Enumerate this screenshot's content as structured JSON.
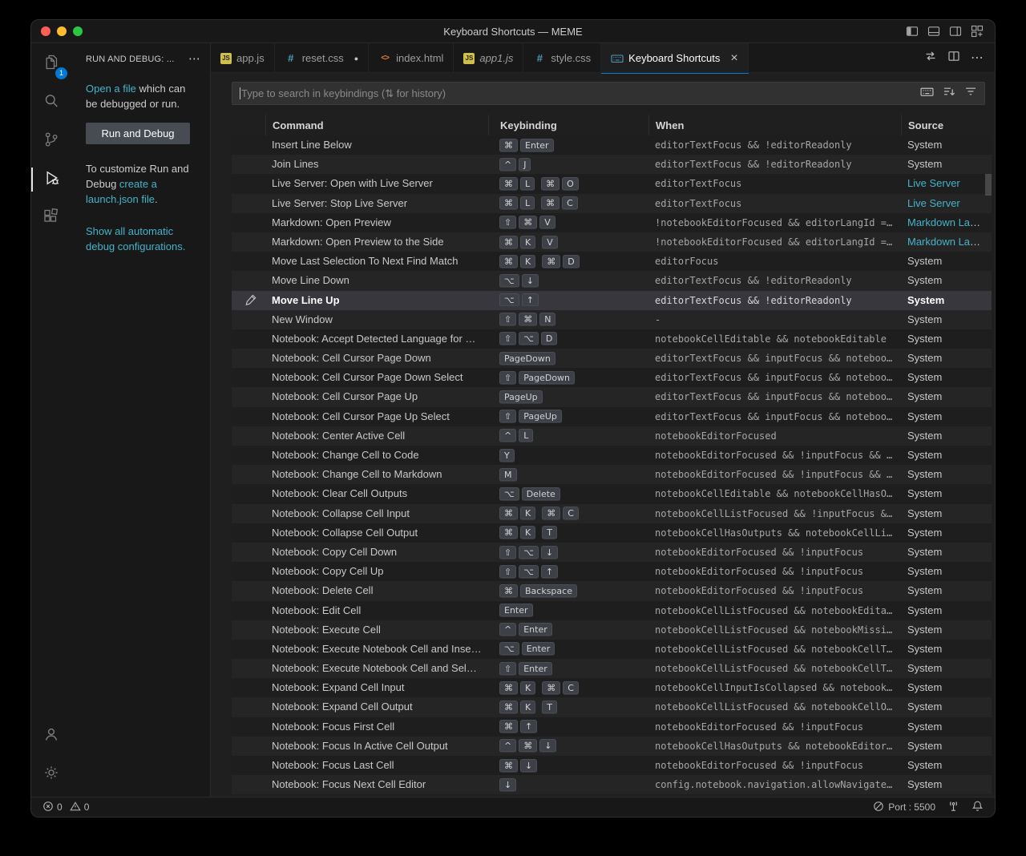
{
  "window": {
    "title": "Keyboard Shortcuts — MEME"
  },
  "titlebar": {
    "controls": [
      "close",
      "minimize",
      "zoom"
    ],
    "layout_icons": [
      "toggle-primary-sidebar",
      "toggle-panel",
      "toggle-secondary-sidebar",
      "customize-layout"
    ]
  },
  "activity_bar": {
    "items": [
      {
        "id": "explorer",
        "icon": "files-icon",
        "badge": "1"
      },
      {
        "id": "search",
        "icon": "search-icon"
      },
      {
        "id": "source-control",
        "icon": "source-control-icon"
      },
      {
        "id": "run-and-debug",
        "icon": "run-debug-icon",
        "active": true
      },
      {
        "id": "extensions",
        "icon": "extensions-icon"
      }
    ],
    "bottom_items": [
      {
        "id": "accounts",
        "icon": "account-icon"
      },
      {
        "id": "settings",
        "icon": "gear-icon"
      }
    ]
  },
  "sidebar": {
    "title": "RUN AND DEBUG: ...",
    "more_actions": "⋯",
    "p1_link": "Open a file",
    "p1_rest": " which can be debugged or run.",
    "run_button": "Run and Debug",
    "p2_pre": "To customize Run and Debug ",
    "p2_link": "create a launch.json file",
    "p2_post": ".",
    "p3_link": "Show all automatic debug configurations."
  },
  "tabs": [
    {
      "label": "app.js",
      "icon": "js-icon"
    },
    {
      "label": "reset.css",
      "icon": "css-icon",
      "modified": true
    },
    {
      "label": "index.html",
      "icon": "html-icon"
    },
    {
      "label": "app1.js",
      "icon": "js-icon",
      "preview": true
    },
    {
      "label": "style.css",
      "icon": "css-icon"
    },
    {
      "label": "Keyboard Shortcuts",
      "icon": "keyboard-icon",
      "active": true
    }
  ],
  "editor_actions": {
    "more": "⋯"
  },
  "search": {
    "placeholder": "Type to search in keybindings (⇅ for history)"
  },
  "table": {
    "headers": [
      "Command",
      "Keybinding",
      "When",
      "Source"
    ],
    "rows": [
      {
        "command": "Insert Line Below",
        "keys": [
          [
            "⌘",
            "Enter"
          ]
        ],
        "when": "editorTextFocus && !editorReadonly",
        "source": "System"
      },
      {
        "command": "Join Lines",
        "keys": [
          [
            "^",
            "J"
          ]
        ],
        "when": "editorTextFocus && !editorReadonly",
        "source": "System"
      },
      {
        "command": "Live Server: Open with Live Server",
        "keys": [
          [
            "⌘",
            "L"
          ],
          [
            "⌘",
            "O"
          ]
        ],
        "when": "editorTextFocus",
        "source": "Live Server",
        "ext": true
      },
      {
        "command": "Live Server: Stop Live Server",
        "keys": [
          [
            "⌘",
            "L"
          ],
          [
            "⌘",
            "C"
          ]
        ],
        "when": "editorTextFocus",
        "source": "Live Server",
        "ext": true
      },
      {
        "command": "Markdown: Open Preview",
        "keys": [
          [
            "⇧",
            "⌘",
            "V"
          ]
        ],
        "when": "!notebookEditorFocused && editorLangId == 'markdown'",
        "source": "Markdown Language Features",
        "ext": true
      },
      {
        "command": "Markdown: Open Preview to the Side",
        "keys": [
          [
            "⌘",
            "K"
          ],
          [
            "V"
          ]
        ],
        "when": "!notebookEditorFocused && editorLangId == 'markdown'",
        "source": "Markdown Language Features",
        "ext": true
      },
      {
        "command": "Move Last Selection To Next Find Match",
        "keys": [
          [
            "⌘",
            "K"
          ],
          [
            "⌘",
            "D"
          ]
        ],
        "when": "editorFocus",
        "source": "System"
      },
      {
        "command": "Move Line Down",
        "keys": [
          [
            "⌥",
            "↓"
          ]
        ],
        "when": "editorTextFocus && !editorReadonly",
        "source": "System"
      },
      {
        "command": "Move Line Up",
        "keys": [
          [
            "⌥",
            "↑"
          ]
        ],
        "when": "editorTextFocus && !editorReadonly",
        "source": "System",
        "selected": true
      },
      {
        "command": "New Window",
        "keys": [
          [
            "⇧",
            "⌘",
            "N"
          ]
        ],
        "when": "-",
        "source": "System"
      },
      {
        "command": "Notebook: Accept Detected Language for Cell",
        "keys": [
          [
            "⇧",
            "⌥",
            "D"
          ]
        ],
        "when": "notebookCellEditable && notebookEditable",
        "source": "System"
      },
      {
        "command": "Notebook: Cell Cursor Page Down",
        "keys": [
          [
            "PageDown"
          ]
        ],
        "when": "editorTextFocus && inputFocus && notebookEditorFocused",
        "source": "System"
      },
      {
        "command": "Notebook: Cell Cursor Page Down Select",
        "keys": [
          [
            "⇧",
            "PageDown"
          ]
        ],
        "when": "editorTextFocus && inputFocus && notebookEditorFocused",
        "source": "System"
      },
      {
        "command": "Notebook: Cell Cursor Page Up",
        "keys": [
          [
            "PageUp"
          ]
        ],
        "when": "editorTextFocus && inputFocus && notebookEditorFocused",
        "source": "System"
      },
      {
        "command": "Notebook: Cell Cursor Page Up Select",
        "keys": [
          [
            "⇧",
            "PageUp"
          ]
        ],
        "when": "editorTextFocus && inputFocus && notebookEditorFocused",
        "source": "System"
      },
      {
        "command": "Notebook: Center Active Cell",
        "keys": [
          [
            "^",
            "L"
          ]
        ],
        "when": "notebookEditorFocused",
        "source": "System"
      },
      {
        "command": "Notebook: Change Cell to Code",
        "keys": [
          [
            "Y"
          ]
        ],
        "when": "notebookEditorFocused && !inputFocus && activeCellType == 'markup'",
        "source": "System"
      },
      {
        "command": "Notebook: Change Cell to Markdown",
        "keys": [
          [
            "M"
          ]
        ],
        "when": "notebookEditorFocused && !inputFocus && activeCellType == 'code'",
        "source": "System"
      },
      {
        "command": "Notebook: Clear Cell Outputs",
        "keys": [
          [
            "⌥",
            "Delete"
          ]
        ],
        "when": "notebookCellEditable && notebookCellHasOutputs",
        "source": "System"
      },
      {
        "command": "Notebook: Collapse Cell Input",
        "keys": [
          [
            "⌘",
            "K"
          ],
          [
            "⌘",
            "C"
          ]
        ],
        "when": "notebookCellListFocused && !inputFocus && !notebookCellInputIsCollapsed",
        "source": "System"
      },
      {
        "command": "Notebook: Collapse Cell Output",
        "keys": [
          [
            "⌘",
            "K"
          ],
          [
            "T"
          ]
        ],
        "when": "notebookCellHasOutputs && notebookCellListFocused && !inputFocus",
        "source": "System"
      },
      {
        "command": "Notebook: Copy Cell Down",
        "keys": [
          [
            "⇧",
            "⌥",
            "↓"
          ]
        ],
        "when": "notebookEditorFocused && !inputFocus",
        "source": "System"
      },
      {
        "command": "Notebook: Copy Cell Up",
        "keys": [
          [
            "⇧",
            "⌥",
            "↑"
          ]
        ],
        "when": "notebookEditorFocused && !inputFocus",
        "source": "System"
      },
      {
        "command": "Notebook: Delete Cell",
        "keys": [
          [
            "⌘",
            "Backspace"
          ]
        ],
        "when": "notebookEditorFocused && !inputFocus",
        "source": "System"
      },
      {
        "command": "Notebook: Edit Cell",
        "keys": [
          [
            "Enter"
          ]
        ],
        "when": "notebookCellListFocused && notebookEditable && !editorHoverFocused",
        "source": "System"
      },
      {
        "command": "Notebook: Execute Cell",
        "keys": [
          [
            "^",
            "Enter"
          ]
        ],
        "when": "notebookCellListFocused && notebookMissingKernelExtension",
        "source": "System"
      },
      {
        "command": "Notebook: Execute Notebook Cell and Insert Below",
        "keys": [
          [
            "⌥",
            "Enter"
          ]
        ],
        "when": "notebookCellListFocused && notebookCellType == 'code'",
        "source": "System"
      },
      {
        "command": "Notebook: Execute Notebook Cell and Select Below",
        "keys": [
          [
            "⇧",
            "Enter"
          ]
        ],
        "when": "notebookCellListFocused && notebookCellType == 'code'",
        "source": "System"
      },
      {
        "command": "Notebook: Expand Cell Input",
        "keys": [
          [
            "⌘",
            "K"
          ],
          [
            "⌘",
            "C"
          ]
        ],
        "when": "notebookCellInputIsCollapsed && notebookCellListFocused",
        "source": "System"
      },
      {
        "command": "Notebook: Expand Cell Output",
        "keys": [
          [
            "⌘",
            "K"
          ],
          [
            "T"
          ]
        ],
        "when": "notebookCellListFocused && notebookCellOutputIsCollapsed",
        "source": "System"
      },
      {
        "command": "Notebook: Focus First Cell",
        "keys": [
          [
            "⌘",
            "↑"
          ]
        ],
        "when": "notebookEditorFocused && !inputFocus",
        "source": "System"
      },
      {
        "command": "Notebook: Focus In Active Cell Output",
        "keys": [
          [
            "^",
            "⌘",
            "↓"
          ]
        ],
        "when": "notebookCellHasOutputs && notebookEditorFocused && !inputFocus",
        "source": "System"
      },
      {
        "command": "Notebook: Focus Last Cell",
        "keys": [
          [
            "⌘",
            "↓"
          ]
        ],
        "when": "notebookEditorFocused && !inputFocus",
        "source": "System"
      },
      {
        "command": "Notebook: Focus Next Cell Editor",
        "keys": [
          [
            "↓"
          ]
        ],
        "when": "config.notebook.navigation.allowNavigateToSurroundingCells",
        "source": "System"
      }
    ]
  },
  "status_bar": {
    "errors": "0",
    "warnings": "0",
    "port": "Port : 5500"
  },
  "colors": {
    "accent_blue": "#0078d4",
    "link_teal": "#45b3c9",
    "chrome_bg": "#181818",
    "editor_bg": "#1f1f1f",
    "selected_row": "#37373d",
    "keycap_bg": "#3d4046",
    "traffic_red": "#ff5f57",
    "traffic_yellow": "#febc2e",
    "traffic_green": "#28c840"
  }
}
